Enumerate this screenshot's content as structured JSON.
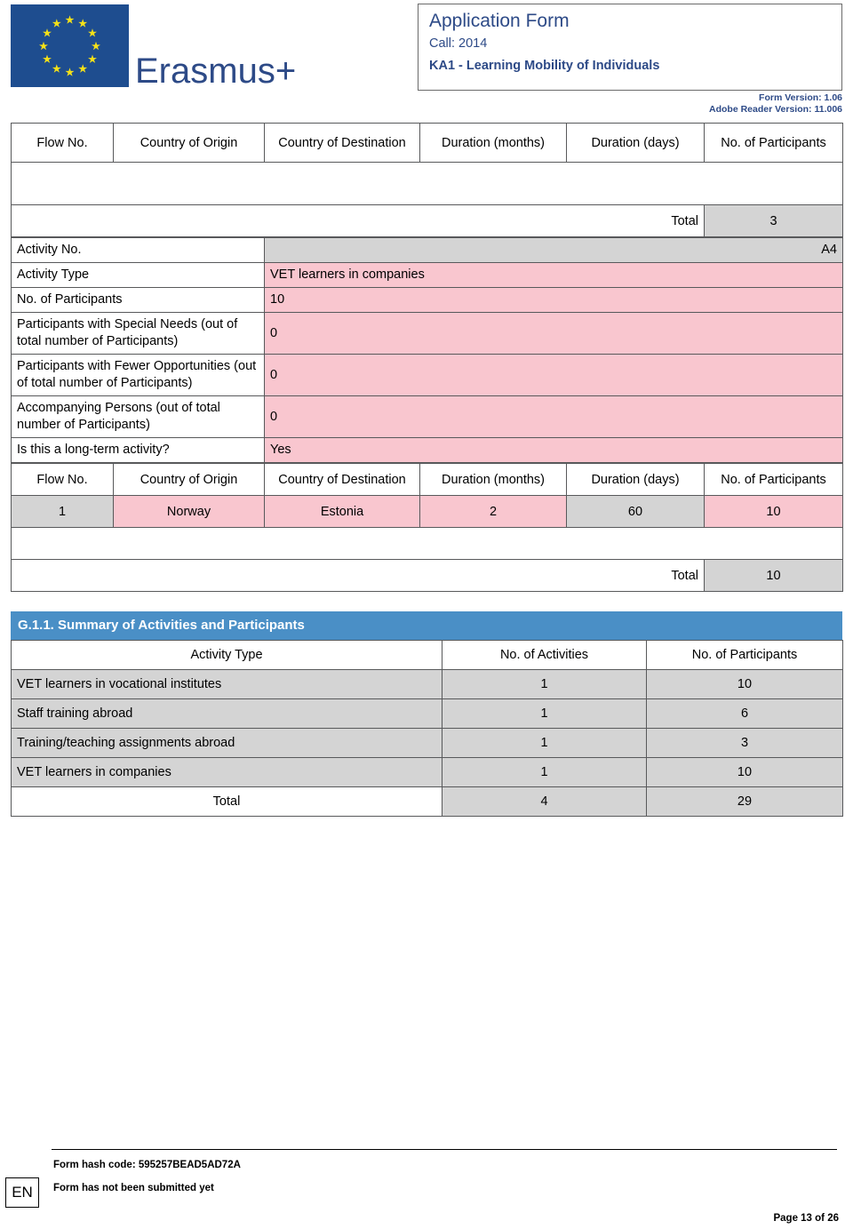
{
  "header": {
    "logo_alt": "Erasmus+",
    "wordmark": "Erasmus+",
    "title": "Application Form",
    "call": "Call: 2014",
    "programme": "KA1 - Learning Mobility of Individuals",
    "form_version": "Form Version: 1.06",
    "reader_version": "Adobe Reader Version: 11.006"
  },
  "flow_table_top": {
    "columns": [
      "Flow No.",
      "Country of Origin",
      "Country of Destination",
      "Duration (months)",
      "Duration (days)",
      "No. of Participants"
    ],
    "rows": [],
    "total_label": "Total",
    "total_value": "3"
  },
  "activity": {
    "activity_no_label": "Activity No.",
    "activity_no_value": "A4",
    "activity_type_label": "Activity Type",
    "activity_type_value": "VET learners in companies",
    "participants_label": "No. of Participants",
    "participants_value": "10",
    "special_needs_label": "Participants with Special Needs (out of total number of Participants)",
    "special_needs_value": "0",
    "fewer_opportunities_label": "Participants with Fewer Opportunities (out of total number of Participants)",
    "fewer_opportunities_value": "0",
    "accompanying_label": "Accompanying Persons (out of total number of Participants)",
    "accompanying_value": "0",
    "long_term_label": "Is this a long-term activity?",
    "long_term_value": "Yes"
  },
  "flow_table_activity": {
    "columns": [
      "Flow No.",
      "Country of Origin",
      "Country of Destination",
      "Duration (months)",
      "Duration (days)",
      "No. of Participants"
    ],
    "rows": [
      {
        "flow_no": "1",
        "origin": "Norway",
        "destination": "Estonia",
        "duration_months": "2",
        "duration_days": "60",
        "participants": "10"
      }
    ],
    "total_label": "Total",
    "total_value": "10"
  },
  "summary_section": {
    "heading": "G.1.1. Summary of Activities and Participants",
    "columns": [
      "Activity Type",
      "No. of Activities",
      "No. of Participants"
    ],
    "rows": [
      {
        "activity_type": "VET learners in vocational institutes",
        "activities": "1",
        "participants": "10"
      },
      {
        "activity_type": "Staff training abroad",
        "activities": "1",
        "participants": "6"
      },
      {
        "activity_type": "Training/teaching assignments abroad",
        "activities": "1",
        "participants": "3"
      },
      {
        "activity_type": "VET learners in companies",
        "activities": "1",
        "participants": "10"
      }
    ],
    "total_label": "Total",
    "total_activities": "4",
    "total_participants": "29"
  },
  "footer": {
    "language": "EN",
    "hash": "Form hash code: 595257BEAD5AD72A",
    "status": "Form has not been submitted yet",
    "page": "Page 13 of 26"
  },
  "colors": {
    "eu_blue": "#1e4d8f",
    "star_yellow": "#f5e118",
    "title_blue": "#2d4a87",
    "section_blue": "#4a8fc6",
    "pink": "#f9c6cf",
    "gray": "#d4d4d4",
    "border": "#58595b"
  }
}
